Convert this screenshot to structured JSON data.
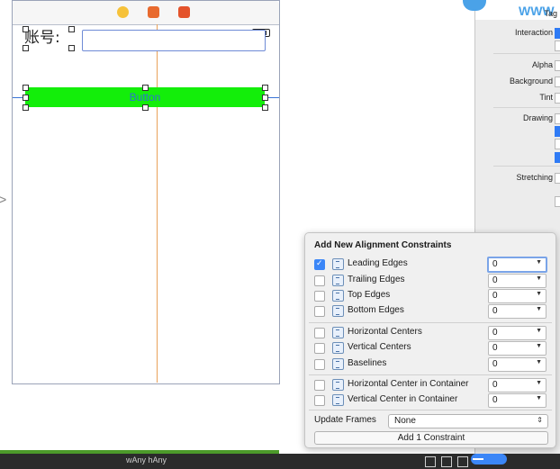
{
  "canvas": {
    "label_text": "账号:",
    "button_title": "Button"
  },
  "inspector": {
    "logo_text": "WWW",
    "rows": {
      "tag": "Tag",
      "interaction": "Interaction",
      "alpha": "Alpha",
      "background": "Background",
      "tint": "Tint",
      "drawing": "Drawing",
      "stretching": "Stretching"
    }
  },
  "popover": {
    "title": "Add New Alignment Constraints",
    "items": [
      {
        "label": "Leading Edges",
        "checked": true,
        "value": "0"
      },
      {
        "label": "Trailing Edges",
        "checked": false,
        "value": "0"
      },
      {
        "label": "Top Edges",
        "checked": false,
        "value": "0"
      },
      {
        "label": "Bottom Edges",
        "checked": false,
        "value": "0"
      },
      {
        "label": "Horizontal Centers",
        "checked": false,
        "value": "0"
      },
      {
        "label": "Vertical Centers",
        "checked": false,
        "value": "0"
      },
      {
        "label": "Baselines",
        "checked": false,
        "value": "0"
      },
      {
        "label": "Horizontal Center in Container",
        "checked": false,
        "value": "0"
      },
      {
        "label": "Vertical Center in Container",
        "checked": false,
        "value": "0"
      }
    ],
    "update_frames_label": "Update Frames",
    "update_frames_value": "None",
    "add_button": "Add 1 Constraint"
  },
  "bottom_bar": {
    "size_class": "wAny hAny"
  },
  "colors": {
    "button_fill": "#13ee0a",
    "button_text": "#2f74d0",
    "guide_vertical": "#e9a25a",
    "accent": "#3b86f7"
  }
}
